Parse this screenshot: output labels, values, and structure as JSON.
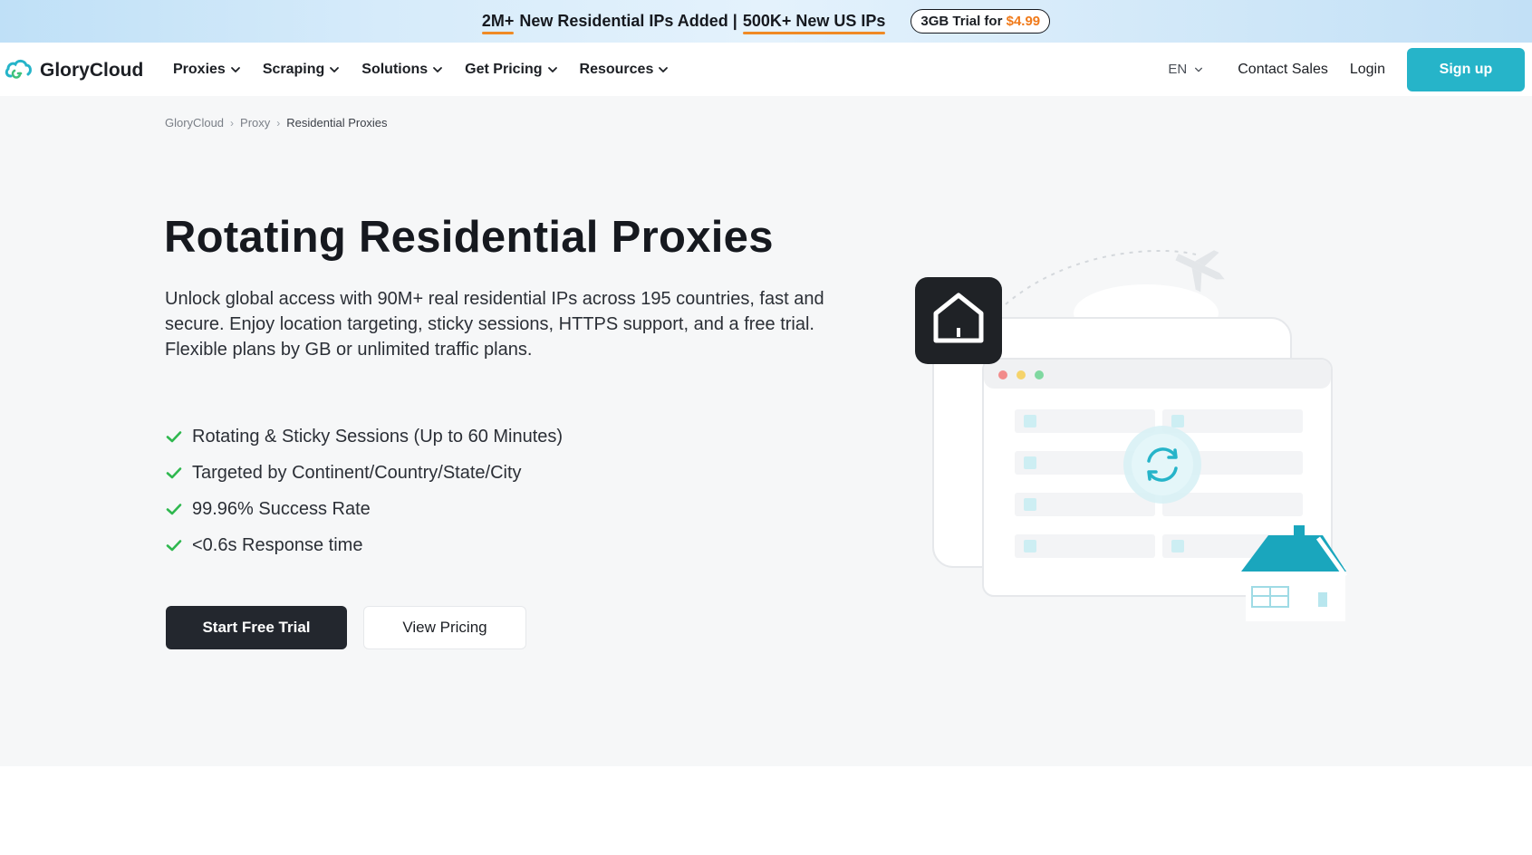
{
  "promo": {
    "part1": "2M+",
    "part2": "New Residential IPs Added |",
    "part3": "500K+ New US IPs",
    "trial_label": "3GB Trial for",
    "trial_price": "$4.99"
  },
  "nav": {
    "brand": "GloryCloud",
    "menu": [
      {
        "label": "Proxies"
      },
      {
        "label": "Scraping"
      },
      {
        "label": "Solutions"
      },
      {
        "label": "Get Pricing"
      },
      {
        "label": "Resources"
      }
    ],
    "lang": "EN",
    "contact": "Contact Sales",
    "login": "Login",
    "signup": "Sign up"
  },
  "breadcrumb": [
    "GloryCloud",
    "Proxy",
    "Residential Proxies"
  ],
  "hero": {
    "title": "Rotating Residential Proxies",
    "description": "Unlock global access with 90M+ real residential IPs across 195 countries, fast and secure. Enjoy location targeting, sticky sessions, HTTPS support, and a free trial. Flexible plans by GB or unlimited traffic plans.",
    "features": [
      "Rotating & Sticky Sessions (Up to 60 Minutes)",
      "Targeted by Continent/Country/State/City",
      "99.96% Success Rate",
      "<0.6s Response time"
    ],
    "primary_cta": "Start Free Trial",
    "secondary_cta": "View Pricing"
  },
  "colors": {
    "accent": "#26b4c9",
    "check": "#2fb84f",
    "promo_underline": "#f08a24",
    "price": "#f07a1a",
    "dark_button": "#23272e"
  },
  "icons": [
    "cloud-logo-icon",
    "chevron-down-icon",
    "check-icon",
    "home-icon",
    "refresh-icon",
    "airplane-icon",
    "house-icon"
  ]
}
